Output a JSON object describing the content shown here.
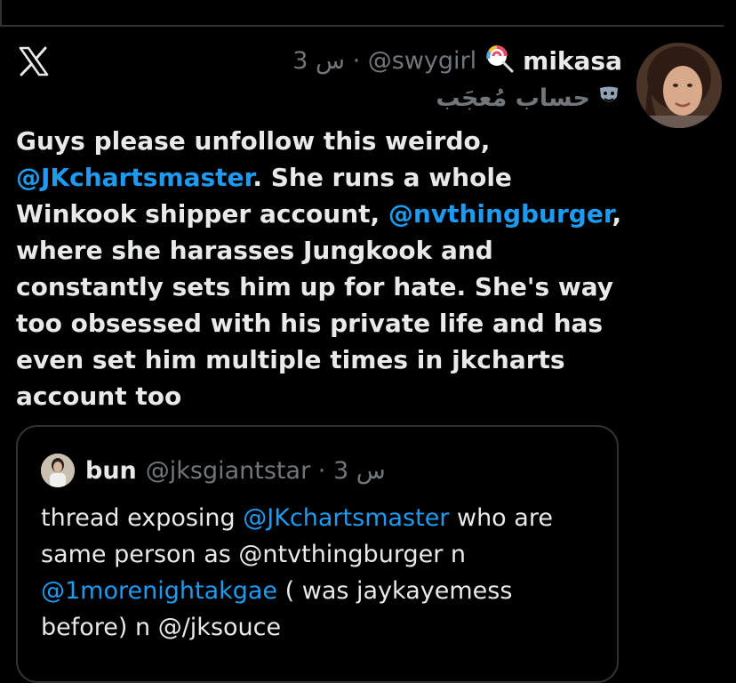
{
  "tweet": {
    "author_name": "mikasa",
    "handle": "@swygirl",
    "time": "3 س",
    "separator": "·",
    "account_label": "حساب مُعجَب",
    "text_parts": [
      {
        "text": "Guys please unfollow this weirdo, "
      },
      {
        "text": "@JKchartsmaster",
        "mention": true
      },
      {
        "text": ". She runs a whole Winkook shipper account, "
      },
      {
        "text": "@nvthingburger",
        "mention": true
      },
      {
        "text": ", where she harasses Jungkook and constantly sets him up for hate. She's way too obsessed with his private life and has even set him multiple times in  jkcharts account too"
      }
    ]
  },
  "quote": {
    "author_name": "bun",
    "handle": "@jksgiantstar",
    "separator": "·",
    "time": "3 س",
    "text_parts": [
      {
        "text": "thread exposing "
      },
      {
        "text": "@JKchartsmaster",
        "mention": true
      },
      {
        "text": " who are same person as @ntvthingburger n "
      },
      {
        "text": "@1morenightakgae",
        "mention": true
      },
      {
        "text": " ( was jaykayemess before) n @/jksouce"
      }
    ]
  },
  "icons": {
    "app_logo": "x-logo-icon",
    "badge": "lollipop-emoji-icon",
    "label_icon": "theater-masks-icon"
  },
  "colors": {
    "background": "#000000",
    "text": "#e7e9ea",
    "muted": "#71767b",
    "link": "#1d9bf0",
    "border": "#2f3336"
  }
}
